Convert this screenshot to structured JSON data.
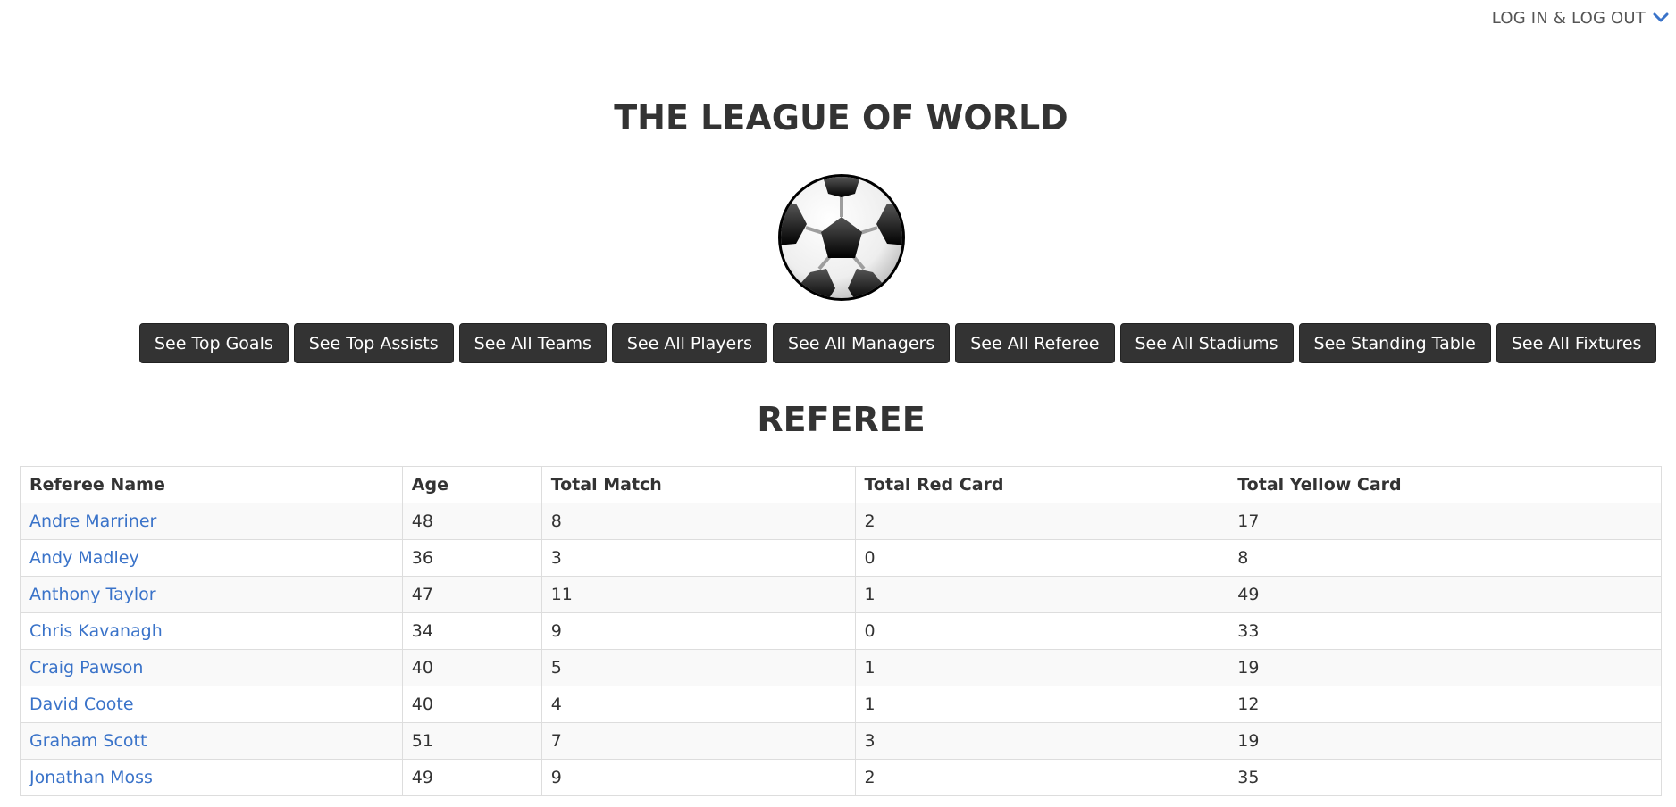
{
  "header": {
    "login_menu_label": "LOG IN & LOG OUT"
  },
  "page": {
    "title": "THE LEAGUE OF WORLD",
    "section_title": "REFEREE"
  },
  "nav": {
    "buttons": [
      "See Top Goals",
      "See Top Assists",
      "See All Teams",
      "See All Players",
      "See All Managers",
      "See All Referee",
      "See All Stadiums",
      "See Standing Table",
      "See All Fixtures"
    ]
  },
  "colors": {
    "button_bg": "#333333",
    "link": "#3a73c9",
    "accent_chevron": "#3a73c9"
  },
  "table": {
    "columns": [
      "Referee Name",
      "Age",
      "Total Match",
      "Total Red Card",
      "Total Yellow Card"
    ],
    "rows": [
      [
        "Andre Marriner",
        "48",
        "8",
        "2",
        "17"
      ],
      [
        "Andy Madley",
        "36",
        "3",
        "0",
        "8"
      ],
      [
        "Anthony Taylor",
        "47",
        "11",
        "1",
        "49"
      ],
      [
        "Chris Kavanagh",
        "34",
        "9",
        "0",
        "33"
      ],
      [
        "Craig Pawson",
        "40",
        "5",
        "1",
        "19"
      ],
      [
        "David Coote",
        "40",
        "4",
        "1",
        "12"
      ],
      [
        "Graham Scott",
        "51",
        "7",
        "3",
        "19"
      ],
      [
        "Jonathan Moss",
        "49",
        "9",
        "2",
        "35"
      ]
    ]
  },
  "icons": {
    "login_chevron": "chevron-down-icon",
    "logo": "soccer-ball-icon"
  }
}
